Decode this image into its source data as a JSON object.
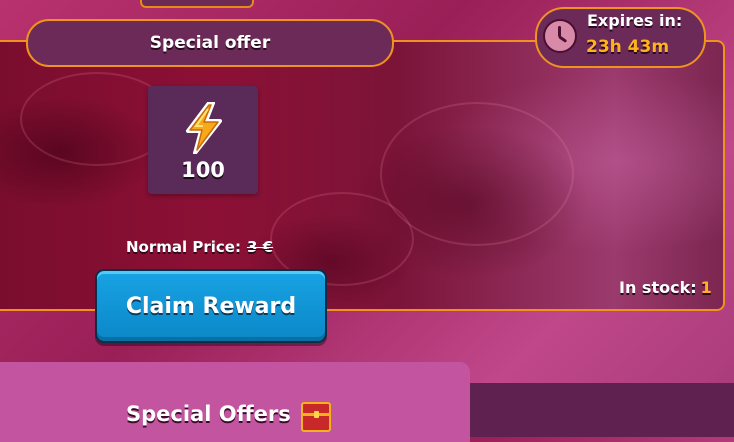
{
  "offer": {
    "title": "Special offer",
    "expires_label": "Expires in:",
    "expires_time": "23h 43m",
    "item_quantity": "100",
    "normal_price_label": "Normal Price:",
    "normal_price_value": "3 €",
    "claim_button": "Claim Reward",
    "stock_label": "In stock:",
    "stock_value": "1"
  },
  "tabs": {
    "special_offers": "Special Offers"
  },
  "icons": {
    "clock": "clock-icon",
    "item": "lightning-bolt-icon",
    "tab": "treasure-chest-icon"
  },
  "colors": {
    "accent_border": "#f0921e",
    "button_blue": "#0b87c7",
    "highlight_text": "#ffb21e"
  }
}
